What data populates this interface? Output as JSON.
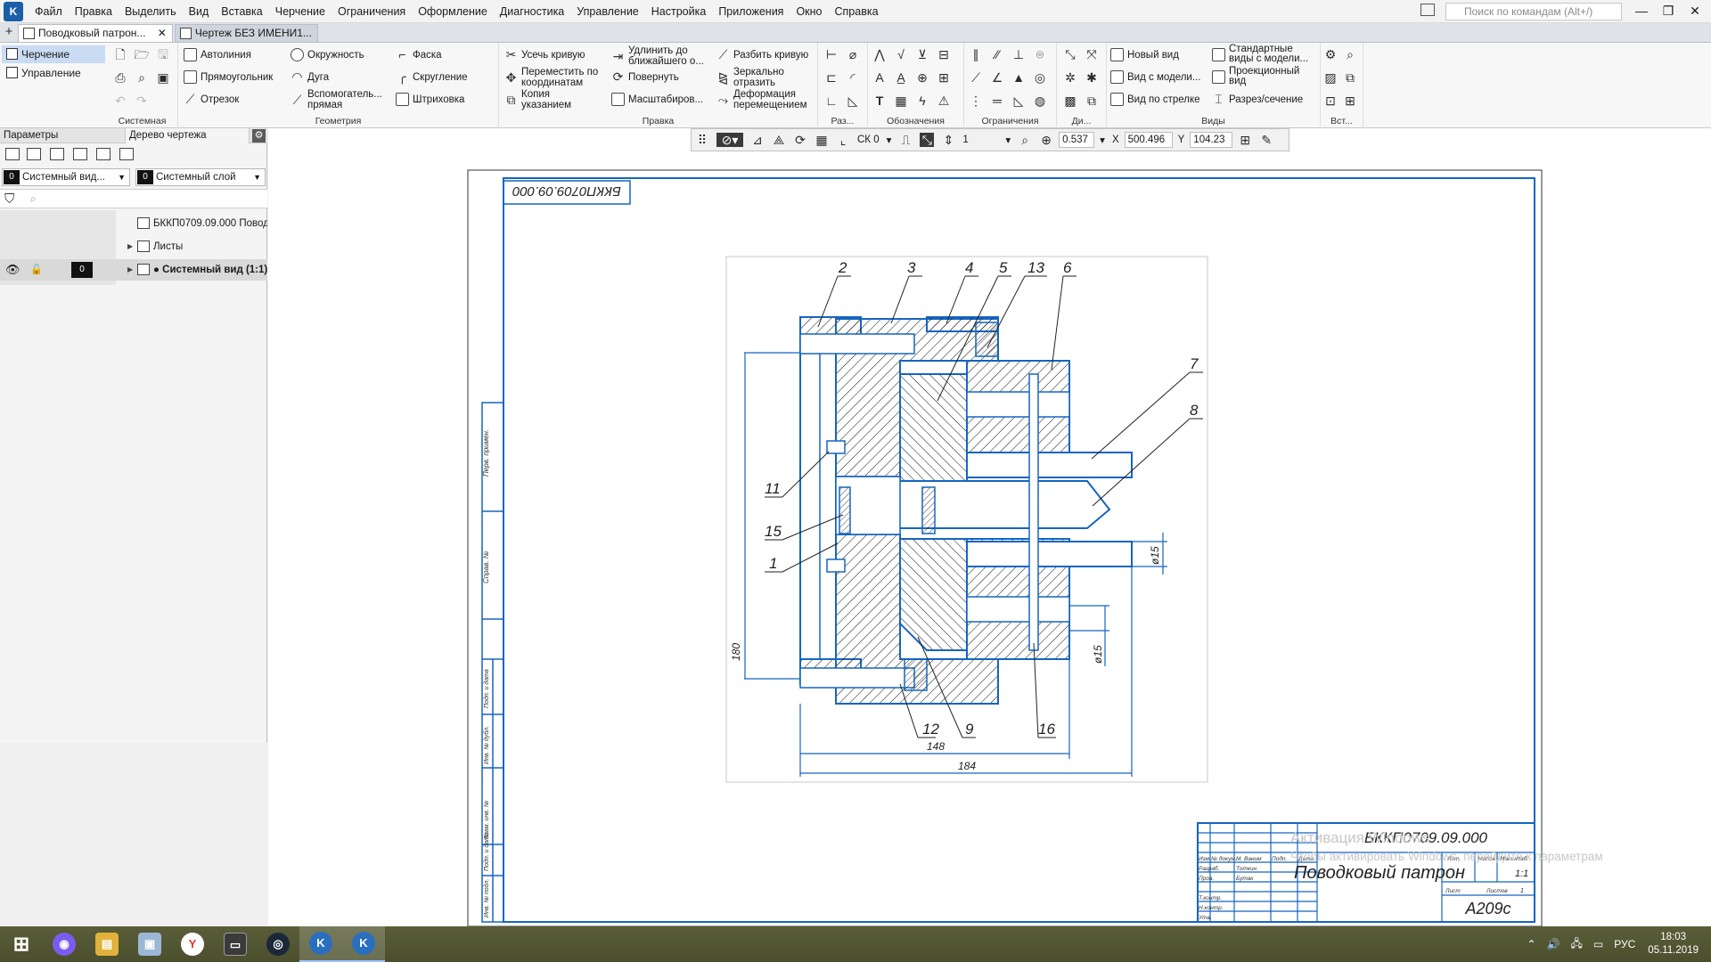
{
  "menubar": {
    "logo": "K",
    "items": [
      "Файл",
      "Правка",
      "Выделить",
      "Вид",
      "Вставка",
      "Черчение",
      "Ограничения",
      "Оформление",
      "Диагностика",
      "Управление",
      "Настройка",
      "Приложения",
      "Окно",
      "Справка"
    ],
    "search_placeholder": "Поиск по командам (Alt+/)",
    "search_icon": "⌕",
    "window_controls": {
      "minimize": "—",
      "restore": "❐",
      "close": "✕"
    }
  },
  "tabs": {
    "add": "+",
    "items": [
      {
        "label": "Поводковый патрон...",
        "close": "✕"
      },
      {
        "label": "Чертеж БЕЗ ИМЕНИ1..."
      }
    ]
  },
  "ribbon": {
    "modes": [
      {
        "label": "Черчение"
      },
      {
        "label": "Управление"
      }
    ],
    "groups": {
      "system": {
        "label": "Системная"
      },
      "geometry": {
        "label": "Геометрия",
        "col1": [
          "Автолиния",
          "Прямоугольник",
          "Отрезок"
        ],
        "col2": [
          "Окружность",
          "Дуга",
          "Вспомогатель... прямая"
        ],
        "col3": [
          "Фаска",
          "Скругление",
          "Штриховка"
        ]
      },
      "edit": {
        "label": "Правка",
        "col1": [
          "Усечь кривую",
          "Переместить по координатам",
          "Копия указанием"
        ],
        "col2": [
          "Удлинить до ближайшего о...",
          "Повернуть",
          "Масштабиров..."
        ],
        "col3": [
          "Разбить кривую",
          "Зеркально отразить",
          "Деформация перемещением"
        ]
      },
      "small": {
        "label": "Раз..."
      },
      "designations": {
        "label": "Обозначения"
      },
      "constraints": {
        "label": "Ограничения"
      },
      "diag": {
        "label": "Ди..."
      },
      "views": {
        "label": "Виды",
        "col1": [
          "Новый вид",
          "Вид с модели...",
          "Вид по стрелке"
        ],
        "col2": [
          "Стандартные виды с модели...",
          "Проекционный вид",
          "Разрез/сечение"
        ]
      },
      "insert": {
        "label": "Вст..."
      }
    }
  },
  "left_panel": {
    "tabs": [
      "Параметры",
      "Дерево чертежа"
    ],
    "gear": "⚙",
    "combo_view": {
      "number": "0",
      "label": "Системный вид..."
    },
    "combo_layer": {
      "number": "0",
      "label": "Системный слой"
    },
    "filter_icon": "⛉",
    "search_icon": "⌕",
    "tree": [
      {
        "label": "БККП0709.09.000 Поводковый патрон"
      },
      {
        "label": "Листы"
      },
      {
        "label": "● Системный вид (1:1)",
        "layer": "0"
      }
    ]
  },
  "view_toolbar": {
    "cs": "СК 0",
    "step": "1",
    "zoom": "0.537",
    "x_label": "X",
    "x": "500.496",
    "y_label": "Y",
    "y": "104.23"
  },
  "drawing": {
    "code_rotated": "БККП0709.09.000",
    "title_code": "БККП0709.09.000",
    "title_name": "Поводковый патрон",
    "scale": "1:1",
    "mass_label": "Масса",
    "scale_label": "Масштаб",
    "lit_label": "Лит.",
    "sheet_label": "Лист",
    "sheets_label": "Листов",
    "sheets_value": "1",
    "group": "А209с",
    "stamp_rows": [
      "Изм.",
      "Лист",
      "№ докум.",
      "Подп.",
      "Дата"
    ],
    "stamp_roles": [
      "Разраб.",
      "Пров.",
      "Т.контр.",
      "Н.контр.",
      "Утв."
    ],
    "stamp_names": [
      "М. Ваним",
      "Тоткин",
      "Бутак"
    ],
    "side_labels": [
      "Перв. примен.",
      "Справ. №",
      "Подп. и дата",
      "Инв. № дубл.",
      "Взам. инв. №",
      "Подп. и дата",
      "Инв. № подл."
    ],
    "callouts": [
      "2",
      "3",
      "4",
      "5",
      "13",
      "6",
      "7",
      "8",
      "11",
      "15",
      "1",
      "12",
      "9",
      "16"
    ],
    "dims": {
      "d180": "180",
      "d148": "148",
      "d184": "184",
      "phi15a": "ø15",
      "phi15b": "ø15"
    },
    "watermark_line1": "Активация Windows",
    "watermark_line2": "Чтобы активировать Windows, перейдите к параметрам"
  },
  "taskbar": {
    "apps": [
      {
        "glyph": "⊞",
        "color": "#ffffff"
      },
      {
        "glyph": "◉",
        "color": "#7b5cf0"
      },
      {
        "glyph": "▤",
        "color": "#e0b23b"
      },
      {
        "glyph": "▣",
        "color": "#9bb7d6"
      },
      {
        "glyph": "Y",
        "color": "#e8322d"
      },
      {
        "glyph": "▭",
        "color": "#3a3a3a"
      },
      {
        "glyph": "◎",
        "color": "#1b2838"
      },
      {
        "glyph": "K",
        "color": "#2a6fbf"
      },
      {
        "glyph": "K",
        "color": "#2a6fbf"
      }
    ],
    "lang": "РУС",
    "time": "18:03",
    "date": "05.11.2019"
  },
  "colors": {
    "drawing_blue": "#1565c0",
    "hatch": "#111111",
    "accent": "#c9dcf3"
  }
}
